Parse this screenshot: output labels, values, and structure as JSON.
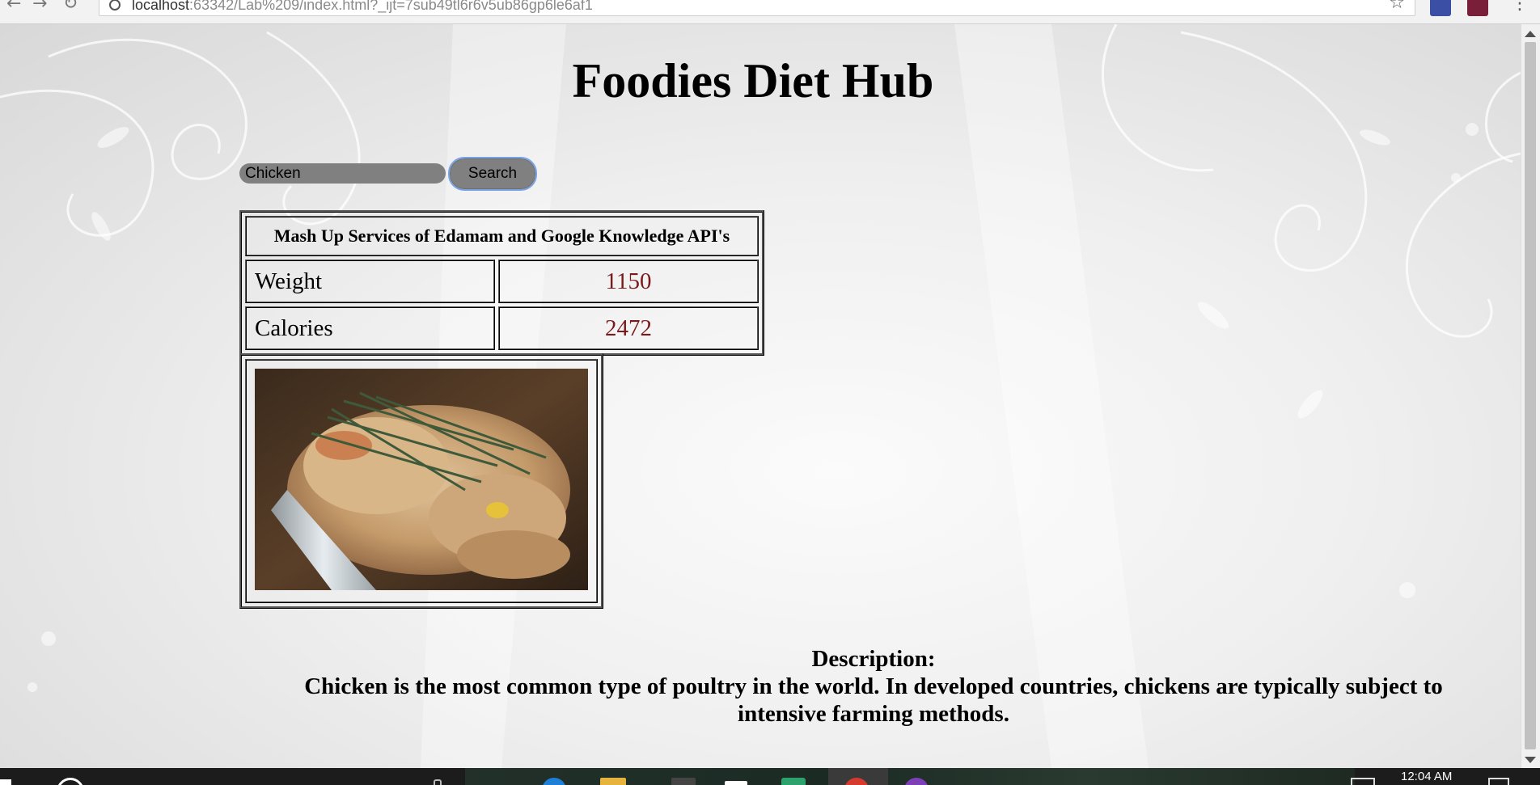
{
  "browser": {
    "url_host": "localhost",
    "url_port_path": ":63342/Lab%209/index.html?_ijt=7sub49tl6r6v5ub86gp6le6af1"
  },
  "page": {
    "title": "Foodies Diet Hub"
  },
  "search": {
    "value": "Chicken",
    "button_label": "Search"
  },
  "results": {
    "header": "Mash Up Services of Edamam and Google Knowledge API's",
    "rows": [
      {
        "label": "Weight",
        "value": "1150"
      },
      {
        "label": "Calories",
        "value": "2472"
      }
    ],
    "image_alt": "Chicken"
  },
  "description": {
    "heading": "Description:",
    "text": "Chicken is the most common type of poultry in the world. In developed countries, chickens are typically subject to intensive farming methods."
  },
  "taskbar": {
    "clock": "12:04 AM"
  },
  "colors": {
    "value_text": "#7a1a1a",
    "search_bg": "#808080",
    "focus_outline": "#7aa3e6"
  }
}
